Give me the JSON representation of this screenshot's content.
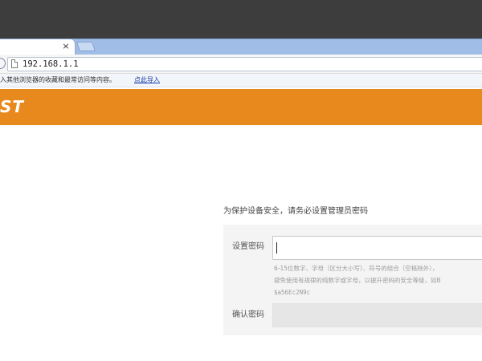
{
  "browser": {
    "tab": {
      "close_glyph": "×"
    },
    "address": {
      "url": "192.168.1.1",
      "page_icon": "page-icon"
    },
    "infobar": {
      "text": "入其他浏览器的收藏和最常访问等内容。",
      "link": "点此导入"
    }
  },
  "brand": {
    "logo_text": "ST",
    "color": "#e8891e"
  },
  "setup": {
    "prompt": "为保护设备安全，请务必设置管理员密码",
    "password_label": "设置密码",
    "password_value": "",
    "hint_line1": "6-15位数字、字母（区分大小写）、符号的组合（空格除外），",
    "hint_line2": "避免使用有规律的纯数字或字母，以提升密码的安全等级，如B",
    "hint_line3": "$a56Ec2N9c",
    "confirm_label": "确认密码",
    "confirm_value": ""
  }
}
